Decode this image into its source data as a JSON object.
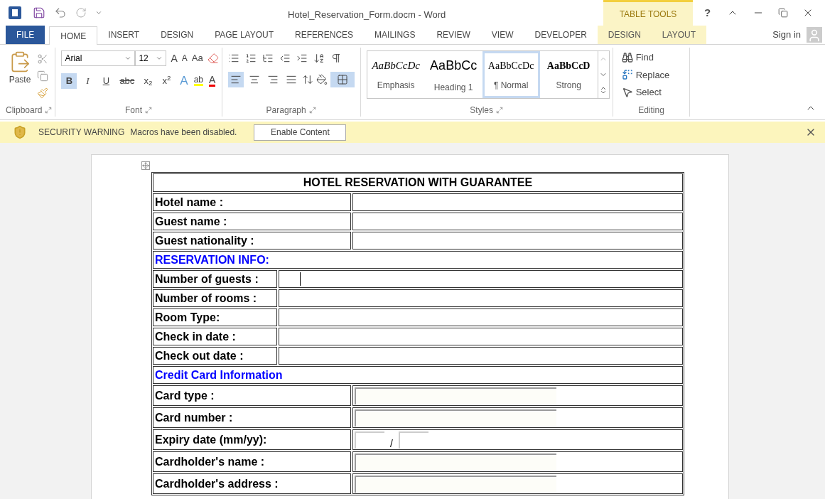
{
  "window": {
    "title": "Hotel_Reservation_Form.docm - Word",
    "context_label": "TABLE TOOLS",
    "help": "?"
  },
  "tabs": [
    {
      "label": "FILE",
      "kind": "file",
      "selected": false
    },
    {
      "label": "HOME",
      "kind": "normal",
      "selected": true
    },
    {
      "label": "INSERT",
      "kind": "normal",
      "selected": false
    },
    {
      "label": "DESIGN",
      "kind": "normal",
      "selected": false
    },
    {
      "label": "PAGE LAYOUT",
      "kind": "normal",
      "selected": false
    },
    {
      "label": "REFERENCES",
      "kind": "normal",
      "selected": false
    },
    {
      "label": "MAILINGS",
      "kind": "normal",
      "selected": false
    },
    {
      "label": "REVIEW",
      "kind": "normal",
      "selected": false
    },
    {
      "label": "VIEW",
      "kind": "normal",
      "selected": false
    },
    {
      "label": "DEVELOPER",
      "kind": "normal",
      "selected": false
    },
    {
      "label": "DESIGN",
      "kind": "contextual",
      "selected": false
    },
    {
      "label": "LAYOUT",
      "kind": "contextual",
      "selected": false
    }
  ],
  "sign_in": "Sign in",
  "ribbon": {
    "clipboard": {
      "paste": "Paste",
      "label": "Clipboard"
    },
    "font": {
      "label": "Font",
      "font_name": "Arial",
      "font_size": "12",
      "case_button": "Aa",
      "grow": "A",
      "shrink": "A",
      "format": [
        {
          "text": "B",
          "kind": "bold",
          "selected": true
        },
        {
          "text": "I",
          "kind": "italic",
          "selected": false
        },
        {
          "text": "U",
          "kind": "underline",
          "selected": false
        },
        {
          "text": "abc",
          "kind": "strike",
          "selected": false
        },
        {
          "text": "x$_{2}$",
          "kind": "plain",
          "selected": false
        },
        {
          "text": "x$^{2}$",
          "kind": "plain",
          "selected": false
        }
      ],
      "effects": "A",
      "highlight": "ab",
      "font_color_letter": "A"
    },
    "paragraph": {
      "label": "Paragraph",
      "align": [
        {
          "kind": "left",
          "selected": true
        },
        {
          "kind": "center",
          "selected": false
        },
        {
          "kind": "right",
          "selected": false
        },
        {
          "kind": "justify",
          "selected": false
        }
      ],
      "borders_selected": true
    },
    "styles": {
      "label": "Styles",
      "items": [
        {
          "preview": "AaBbCcDc",
          "label": "Emphasis",
          "kind": "emphasis",
          "selected": false
        },
        {
          "preview": "AaBbCc",
          "label": "Heading 1",
          "kind": "heading",
          "selected": false
        },
        {
          "preview": "AaBbCcDc",
          "label": "¶ Normal",
          "kind": "normal",
          "selected": true
        },
        {
          "preview": "AaBbCcD",
          "label": "Strong",
          "kind": "strong",
          "selected": false
        }
      ]
    },
    "editing": {
      "label": "Editing",
      "find": "Find",
      "replace": "Replace",
      "select": "Select"
    }
  },
  "security_bar": {
    "title": "SECURITY WARNING",
    "message": "Macros have been disabled.",
    "button": "Enable Content"
  },
  "form": [
    {
      "kind": "title",
      "text": "HOTEL RESERVATION WITH GUARANTEE"
    },
    {
      "kind": "wide_field",
      "label": "Hotel name :"
    },
    {
      "kind": "wide_field",
      "label": "Guest name :"
    },
    {
      "kind": "wide_field",
      "label": "Guest nationality :"
    },
    {
      "kind": "section",
      "text": "RESERVATION INFO:"
    },
    {
      "kind": "narrow_field",
      "label": "Number of guests :",
      "cursor": true
    },
    {
      "kind": "narrow_field",
      "label": "Number of rooms :"
    },
    {
      "kind": "narrow_field",
      "label": "Room Type:"
    },
    {
      "kind": "narrow_field",
      "label": "Check in date :"
    },
    {
      "kind": "narrow_field",
      "label": "Check out date :"
    },
    {
      "kind": "section",
      "text": "Credit Card Information"
    },
    {
      "kind": "input",
      "label": "Card type :"
    },
    {
      "kind": "input",
      "label": "Card number :"
    },
    {
      "kind": "date",
      "label": "Expiry date (mm/yy):",
      "separator": "/"
    },
    {
      "kind": "input",
      "label": "Cardholder's name :"
    },
    {
      "kind": "input",
      "label": "Cardholder's address :"
    }
  ]
}
